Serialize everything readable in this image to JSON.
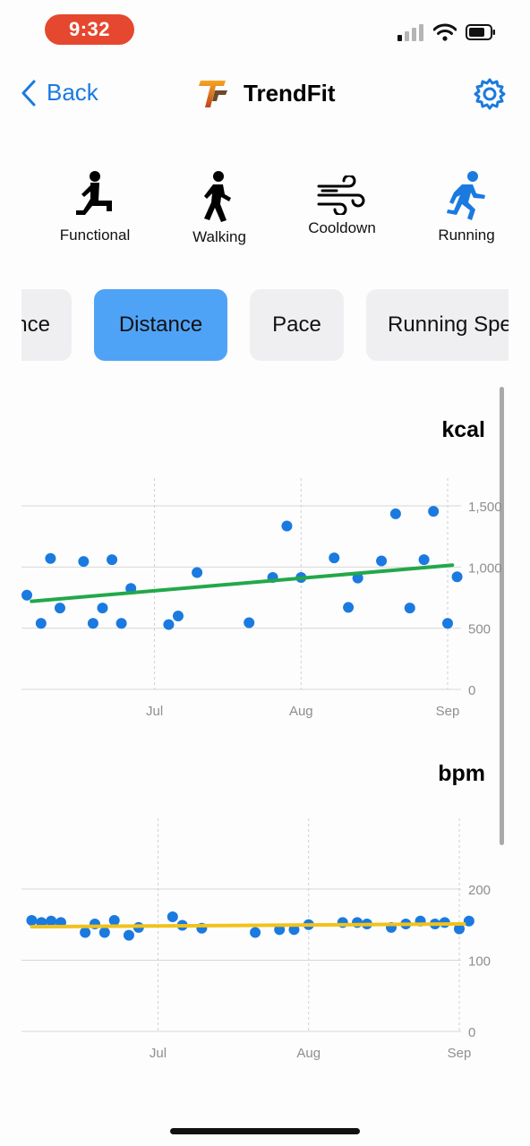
{
  "status": {
    "time": "9:32"
  },
  "nav": {
    "back_label": "Back",
    "title": "TrendFit"
  },
  "activities": [
    {
      "label": "Functional",
      "icon": "functional-training-icon"
    },
    {
      "label": "Walking",
      "icon": "walking-icon"
    },
    {
      "label": "Cooldown",
      "icon": "wind-icon"
    },
    {
      "label": "Running",
      "icon": "running-icon"
    }
  ],
  "tabs": [
    {
      "label": "nce"
    },
    {
      "label": "Distance",
      "active": true
    },
    {
      "label": "Pace"
    },
    {
      "label": "Running Spe"
    }
  ],
  "colors": {
    "accent": "#1a7ae0",
    "active_tab": "#4fa3f7",
    "point": "#1a7ae0",
    "trend_kcal": "#22a84a",
    "trend_bpm": "#f1c21b",
    "time_pill": "#e5482f"
  },
  "chart_data": [
    {
      "type": "scatter",
      "title": "kcal",
      "x_ticks": [
        "Jul",
        "Aug",
        "Sep"
      ],
      "y_ticks": [
        "0",
        "500",
        "1,000",
        "1,500"
      ],
      "ylim": [
        0,
        1500
      ],
      "xlim": [
        "2024-06-04",
        "2024-09-04"
      ],
      "grid": true,
      "points": [
        {
          "x": "2024-06-04",
          "y": 770
        },
        {
          "x": "2024-06-07",
          "y": 540
        },
        {
          "x": "2024-06-09",
          "y": 1070
        },
        {
          "x": "2024-06-11",
          "y": 665
        },
        {
          "x": "2024-06-16",
          "y": 1045
        },
        {
          "x": "2024-06-18",
          "y": 540
        },
        {
          "x": "2024-06-20",
          "y": 665
        },
        {
          "x": "2024-06-22",
          "y": 1060
        },
        {
          "x": "2024-06-24",
          "y": 540
        },
        {
          "x": "2024-06-26",
          "y": 825
        },
        {
          "x": "2024-07-04",
          "y": 530
        },
        {
          "x": "2024-07-06",
          "y": 600
        },
        {
          "x": "2024-07-10",
          "y": 955
        },
        {
          "x": "2024-07-21",
          "y": 545
        },
        {
          "x": "2024-07-26",
          "y": 915
        },
        {
          "x": "2024-07-29",
          "y": 1335
        },
        {
          "x": "2024-08-01",
          "y": 915
        },
        {
          "x": "2024-08-08",
          "y": 1075
        },
        {
          "x": "2024-08-11",
          "y": 670
        },
        {
          "x": "2024-08-13",
          "y": 910
        },
        {
          "x": "2024-08-18",
          "y": 1050
        },
        {
          "x": "2024-08-21",
          "y": 1435
        },
        {
          "x": "2024-08-24",
          "y": 665
        },
        {
          "x": "2024-08-27",
          "y": 1060
        },
        {
          "x": "2024-08-29",
          "y": 1455
        },
        {
          "x": "2024-09-01",
          "y": 540
        },
        {
          "x": "2024-09-03",
          "y": 920
        }
      ],
      "trend": {
        "from": {
          "x": "2024-06-05",
          "y": 720
        },
        "to": {
          "x": "2024-09-02",
          "y": 1015
        }
      }
    },
    {
      "type": "scatter",
      "title": "bpm",
      "x_ticks": [
        "Jul",
        "Aug",
        "Sep"
      ],
      "y_ticks": [
        "0",
        "100",
        "200"
      ],
      "ylim": [
        0,
        200
      ],
      "xlim": [
        "2024-06-04",
        "2024-09-04"
      ],
      "grid": true,
      "points": [
        {
          "x": "2024-06-05",
          "y": 156
        },
        {
          "x": "2024-06-07",
          "y": 153
        },
        {
          "x": "2024-06-09",
          "y": 155
        },
        {
          "x": "2024-06-11",
          "y": 153
        },
        {
          "x": "2024-06-16",
          "y": 139
        },
        {
          "x": "2024-06-18",
          "y": 151
        },
        {
          "x": "2024-06-20",
          "y": 139
        },
        {
          "x": "2024-06-22",
          "y": 156
        },
        {
          "x": "2024-06-25",
          "y": 135
        },
        {
          "x": "2024-06-27",
          "y": 146
        },
        {
          "x": "2024-07-04",
          "y": 161
        },
        {
          "x": "2024-07-06",
          "y": 149
        },
        {
          "x": "2024-07-10",
          "y": 145
        },
        {
          "x": "2024-07-21",
          "y": 139
        },
        {
          "x": "2024-07-26",
          "y": 143
        },
        {
          "x": "2024-07-29",
          "y": 143
        },
        {
          "x": "2024-08-01",
          "y": 150
        },
        {
          "x": "2024-08-08",
          "y": 153
        },
        {
          "x": "2024-08-11",
          "y": 153
        },
        {
          "x": "2024-08-13",
          "y": 151
        },
        {
          "x": "2024-08-18",
          "y": 146
        },
        {
          "x": "2024-08-21",
          "y": 151
        },
        {
          "x": "2024-08-24",
          "y": 155
        },
        {
          "x": "2024-08-27",
          "y": 151
        },
        {
          "x": "2024-08-29",
          "y": 153
        },
        {
          "x": "2024-09-01",
          "y": 144
        },
        {
          "x": "2024-09-03",
          "y": 155
        }
      ],
      "trend": {
        "from": {
          "x": "2024-06-05",
          "y": 147
        },
        "to": {
          "x": "2024-09-02",
          "y": 151
        }
      }
    }
  ]
}
